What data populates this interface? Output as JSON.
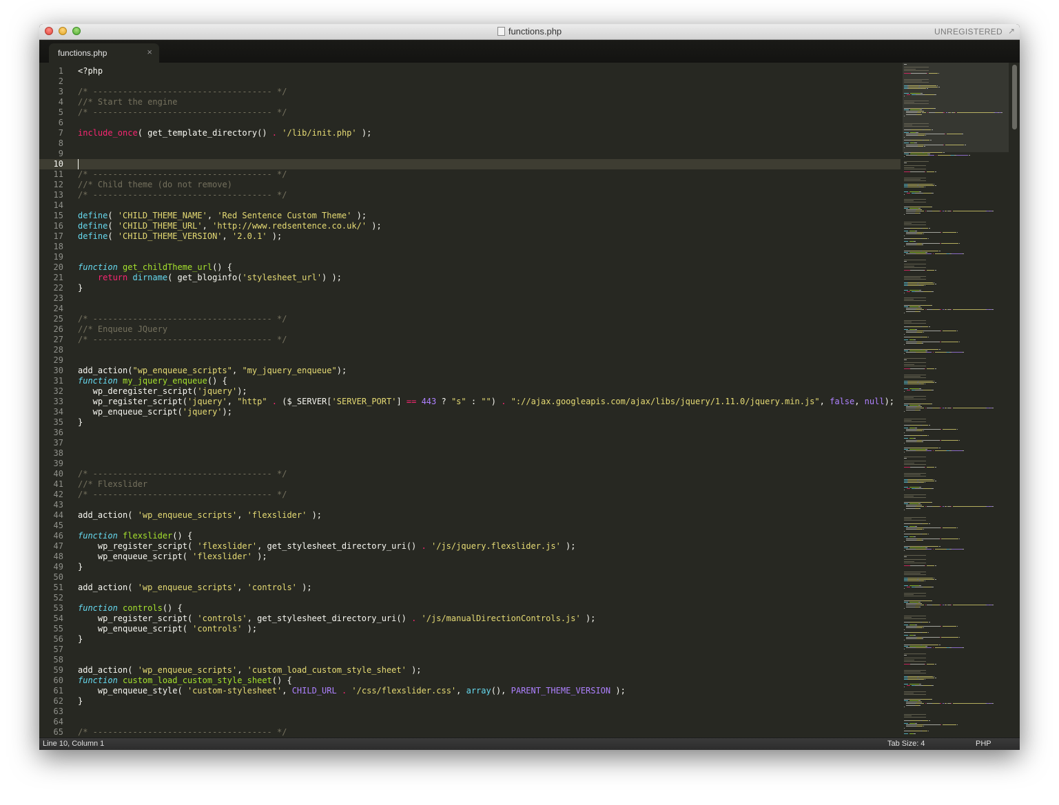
{
  "window": {
    "title": "functions.php",
    "registration": "UNREGISTERED",
    "fullscreen_icon": "expand-arrows-icon",
    "file_icon": "php-file-icon"
  },
  "tabs": [
    {
      "label": "functions.php",
      "close_icon": "close-icon",
      "active": true
    }
  ],
  "editor": {
    "current_line": 10,
    "theme_colors": {
      "background": "#272822",
      "foreground": "#f8f8f2",
      "comment": "#75715e",
      "keyword": "#f92672",
      "function_name": "#a6e22e",
      "support": "#66d9ef",
      "string": "#e6db74",
      "constant": "#ae81ff"
    },
    "lines": [
      {
        "n": "1",
        "tokens": [
          [
            "t",
            "<?php"
          ]
        ]
      },
      {
        "n": "2",
        "tokens": []
      },
      {
        "n": "3",
        "tokens": [
          [
            "com",
            "/* ------------------------------------ */"
          ]
        ]
      },
      {
        "n": "4",
        "tokens": [
          [
            "com",
            "//* Start the engine"
          ]
        ]
      },
      {
        "n": "5",
        "tokens": [
          [
            "com",
            "/* ------------------------------------ */"
          ]
        ]
      },
      {
        "n": "6",
        "tokens": []
      },
      {
        "n": "7",
        "tokens": [
          [
            "kw",
            "include_once"
          ],
          [
            "t",
            "( get_template_directory() "
          ],
          [
            "kw",
            "."
          ],
          [
            "t",
            " "
          ],
          [
            "str",
            "'/lib/init.php'"
          ],
          [
            "t",
            " );"
          ]
        ]
      },
      {
        "n": "8",
        "tokens": []
      },
      {
        "n": "9",
        "tokens": []
      },
      {
        "n": "10",
        "tokens": []
      },
      {
        "n": "11",
        "tokens": [
          [
            "com",
            "/* ------------------------------------ */"
          ]
        ]
      },
      {
        "n": "12",
        "tokens": [
          [
            "com",
            "//* Child theme (do not remove)"
          ]
        ]
      },
      {
        "n": "13",
        "tokens": [
          [
            "com",
            "/* ------------------------------------ */"
          ]
        ]
      },
      {
        "n": "14",
        "tokens": []
      },
      {
        "n": "15",
        "tokens": [
          [
            "sp",
            "define"
          ],
          [
            "t",
            "( "
          ],
          [
            "str",
            "'CHILD_THEME_NAME'"
          ],
          [
            "t",
            ", "
          ],
          [
            "str",
            "'Red Sentence Custom Theme'"
          ],
          [
            "t",
            " );"
          ]
        ]
      },
      {
        "n": "16",
        "tokens": [
          [
            "sp",
            "define"
          ],
          [
            "t",
            "( "
          ],
          [
            "str",
            "'CHILD_THEME_URL'"
          ],
          [
            "t",
            ", "
          ],
          [
            "str",
            "'http://www.redsentence.co.uk/'"
          ],
          [
            "t",
            " );"
          ]
        ]
      },
      {
        "n": "17",
        "tokens": [
          [
            "sp",
            "define"
          ],
          [
            "t",
            "( "
          ],
          [
            "str",
            "'CHILD_THEME_VERSION'"
          ],
          [
            "t",
            ", "
          ],
          [
            "str",
            "'2.0.1'"
          ],
          [
            "t",
            " );"
          ]
        ]
      },
      {
        "n": "18",
        "tokens": []
      },
      {
        "n": "19",
        "tokens": []
      },
      {
        "n": "20",
        "tokens": [
          [
            "st",
            "function"
          ],
          [
            "t",
            " "
          ],
          [
            "fn",
            "get_childTheme_url"
          ],
          [
            "t",
            "() {"
          ]
        ]
      },
      {
        "n": "21",
        "tokens": [
          [
            "t",
            "    "
          ],
          [
            "kw",
            "return"
          ],
          [
            "t",
            " "
          ],
          [
            "sp",
            "dirname"
          ],
          [
            "t",
            "( get_bloginfo("
          ],
          [
            "str",
            "'stylesheet_url'"
          ],
          [
            "t",
            ") );"
          ]
        ]
      },
      {
        "n": "22",
        "tokens": [
          [
            "t",
            "}"
          ]
        ]
      },
      {
        "n": "23",
        "tokens": []
      },
      {
        "n": "24",
        "tokens": []
      },
      {
        "n": "25",
        "tokens": [
          [
            "com",
            "/* ------------------------------------ */"
          ]
        ]
      },
      {
        "n": "26",
        "tokens": [
          [
            "com",
            "//* Enqueue JQuery"
          ]
        ]
      },
      {
        "n": "27",
        "tokens": [
          [
            "com",
            "/* ------------------------------------ */"
          ]
        ]
      },
      {
        "n": "28",
        "tokens": []
      },
      {
        "n": "29",
        "tokens": []
      },
      {
        "n": "30",
        "tokens": [
          [
            "t",
            "add_action("
          ],
          [
            "str",
            "\"wp_enqueue_scripts\""
          ],
          [
            "t",
            ", "
          ],
          [
            "str",
            "\"my_jquery_enqueue\""
          ],
          [
            "t",
            ");"
          ]
        ]
      },
      {
        "n": "31",
        "tokens": [
          [
            "st",
            "function"
          ],
          [
            "t",
            " "
          ],
          [
            "fn",
            "my_jquery_enqueue"
          ],
          [
            "t",
            "() {"
          ]
        ]
      },
      {
        "n": "32",
        "tokens": [
          [
            "t",
            "   wp_deregister_script("
          ],
          [
            "str",
            "'jquery'"
          ],
          [
            "t",
            ");"
          ]
        ]
      },
      {
        "n": "33",
        "tokens": [
          [
            "t",
            "   wp_register_script("
          ],
          [
            "str",
            "'jquery'"
          ],
          [
            "t",
            ", "
          ],
          [
            "str",
            "\"http\""
          ],
          [
            "t",
            " "
          ],
          [
            "kw",
            "."
          ],
          [
            "t",
            " ($_SERVER["
          ],
          [
            "str",
            "'SERVER_PORT'"
          ],
          [
            "t",
            "] "
          ],
          [
            "kw",
            "=="
          ],
          [
            "t",
            " "
          ],
          [
            "num",
            "443"
          ],
          [
            "t",
            " ? "
          ],
          [
            "str",
            "\"s\""
          ],
          [
            "t",
            " : "
          ],
          [
            "str",
            "\"\""
          ],
          [
            "t",
            ") "
          ],
          [
            "kw",
            "."
          ],
          [
            "t",
            " "
          ],
          [
            "str",
            "\"://ajax.googleapis.com/ajax/libs/jquery/1.11.0/jquery.min.js\""
          ],
          [
            "t",
            ", "
          ],
          [
            "con",
            "false"
          ],
          [
            "t",
            ", "
          ],
          [
            "con",
            "null"
          ],
          [
            "t",
            ");"
          ]
        ]
      },
      {
        "n": "34",
        "tokens": [
          [
            "t",
            "   wp_enqueue_script("
          ],
          [
            "str",
            "'jquery'"
          ],
          [
            "t",
            ");"
          ]
        ]
      },
      {
        "n": "35",
        "tokens": [
          [
            "t",
            "}"
          ]
        ]
      },
      {
        "n": "36",
        "tokens": []
      },
      {
        "n": "37",
        "tokens": []
      },
      {
        "n": "38",
        "tokens": []
      },
      {
        "n": "39",
        "tokens": []
      },
      {
        "n": "40",
        "tokens": [
          [
            "com",
            "/* ------------------------------------ */"
          ]
        ]
      },
      {
        "n": "41",
        "tokens": [
          [
            "com",
            "//* Flexslider"
          ]
        ]
      },
      {
        "n": "42",
        "tokens": [
          [
            "com",
            "/* ------------------------------------ */"
          ]
        ]
      },
      {
        "n": "43",
        "tokens": []
      },
      {
        "n": "44",
        "tokens": [
          [
            "t",
            "add_action( "
          ],
          [
            "str",
            "'wp_enqueue_scripts'"
          ],
          [
            "t",
            ", "
          ],
          [
            "str",
            "'flexslider'"
          ],
          [
            "t",
            " );"
          ]
        ]
      },
      {
        "n": "45",
        "tokens": []
      },
      {
        "n": "46",
        "tokens": [
          [
            "st",
            "function"
          ],
          [
            "t",
            " "
          ],
          [
            "fn",
            "flexslider"
          ],
          [
            "t",
            "() {"
          ]
        ]
      },
      {
        "n": "47",
        "tokens": [
          [
            "t",
            "    wp_register_script( "
          ],
          [
            "str",
            "'flexslider'"
          ],
          [
            "t",
            ", get_stylesheet_directory_uri() "
          ],
          [
            "kw",
            "."
          ],
          [
            "t",
            " "
          ],
          [
            "str",
            "'/js/jquery.flexslider.js'"
          ],
          [
            "t",
            " );"
          ]
        ]
      },
      {
        "n": "48",
        "tokens": [
          [
            "t",
            "    wp_enqueue_script( "
          ],
          [
            "str",
            "'flexslider'"
          ],
          [
            "t",
            " );"
          ]
        ]
      },
      {
        "n": "49",
        "tokens": [
          [
            "t",
            "}"
          ]
        ]
      },
      {
        "n": "50",
        "tokens": []
      },
      {
        "n": "51",
        "tokens": [
          [
            "t",
            "add_action( "
          ],
          [
            "str",
            "'wp_enqueue_scripts'"
          ],
          [
            "t",
            ", "
          ],
          [
            "str",
            "'controls'"
          ],
          [
            "t",
            " );"
          ]
        ]
      },
      {
        "n": "52",
        "tokens": []
      },
      {
        "n": "53",
        "tokens": [
          [
            "st",
            "function"
          ],
          [
            "t",
            " "
          ],
          [
            "fn",
            "controls"
          ],
          [
            "t",
            "() {"
          ]
        ]
      },
      {
        "n": "54",
        "tokens": [
          [
            "t",
            "    wp_register_script( "
          ],
          [
            "str",
            "'controls'"
          ],
          [
            "t",
            ", get_stylesheet_directory_uri() "
          ],
          [
            "kw",
            "."
          ],
          [
            "t",
            " "
          ],
          [
            "str",
            "'/js/manualDirectionControls.js'"
          ],
          [
            "t",
            " );"
          ]
        ]
      },
      {
        "n": "55",
        "tokens": [
          [
            "t",
            "    wp_enqueue_script( "
          ],
          [
            "str",
            "'controls'"
          ],
          [
            "t",
            " );"
          ]
        ]
      },
      {
        "n": "56",
        "tokens": [
          [
            "t",
            "}"
          ]
        ]
      },
      {
        "n": "57",
        "tokens": []
      },
      {
        "n": "58",
        "tokens": []
      },
      {
        "n": "59",
        "tokens": [
          [
            "t",
            "add_action( "
          ],
          [
            "str",
            "'wp_enqueue_scripts'"
          ],
          [
            "t",
            ", "
          ],
          [
            "str",
            "'custom_load_custom_style_sheet'"
          ],
          [
            "t",
            " );"
          ]
        ]
      },
      {
        "n": "60",
        "tokens": [
          [
            "st",
            "function"
          ],
          [
            "t",
            " "
          ],
          [
            "fn",
            "custom_load_custom_style_sheet"
          ],
          [
            "t",
            "() {"
          ]
        ]
      },
      {
        "n": "61",
        "tokens": [
          [
            "t",
            "    wp_enqueue_style( "
          ],
          [
            "str",
            "'custom-stylesheet'"
          ],
          [
            "t",
            ", "
          ],
          [
            "con",
            "CHILD_URL"
          ],
          [
            "t",
            " "
          ],
          [
            "kw",
            "."
          ],
          [
            "t",
            " "
          ],
          [
            "str",
            "'/css/flexslider.css'"
          ],
          [
            "t",
            ", "
          ],
          [
            "sp",
            "array"
          ],
          [
            "t",
            "(), "
          ],
          [
            "con",
            "PARENT_THEME_VERSION"
          ],
          [
            "t",
            " );"
          ]
        ]
      },
      {
        "n": "62",
        "tokens": [
          [
            "t",
            "}"
          ]
        ]
      },
      {
        "n": "63",
        "tokens": []
      },
      {
        "n": "64",
        "tokens": []
      },
      {
        "n": "65",
        "tokens": [
          [
            "com",
            "/* ------------------------------------ */"
          ]
        ]
      }
    ]
  },
  "statusbar": {
    "position": "Line 10, Column 1",
    "tab_size": "Tab Size: 4",
    "syntax": "PHP"
  }
}
